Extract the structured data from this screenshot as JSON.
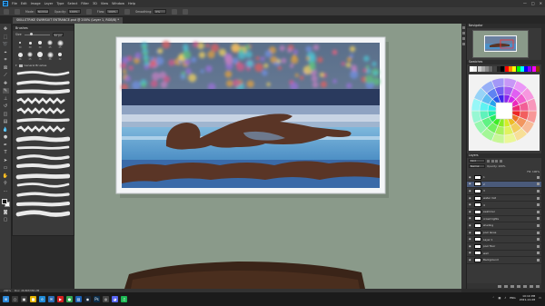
{
  "app": {
    "logo_text": "Ps",
    "menu": [
      "File",
      "Edit",
      "Image",
      "Layer",
      "Type",
      "Select",
      "Filter",
      "3D",
      "View",
      "Window",
      "Help"
    ],
    "window_controls": [
      "—",
      "□",
      "✕"
    ]
  },
  "options_bar": {
    "mode_label": "Mode:",
    "mode_value": "Normal",
    "opacity_label": "Opacity:",
    "opacity_value": "100%",
    "flow_label": "Flow:",
    "flow_value": "100%",
    "smoothing_label": "Smoothing:",
    "smoothing_value": "0%"
  },
  "document": {
    "tab_title": "SKILLSTRIKE SWIMSUIT ENTRANCE.psd @ 200% (Layer 1, RGB/8) *",
    "status_zoom": "200%",
    "status_doc": "Doc: 26.8M/336.2M"
  },
  "brushes_panel": {
    "title": "Brushes",
    "size_label": "Size",
    "size_value": "50 px",
    "preset_sizes": [
      "30",
      "30",
      "30",
      "25",
      "25",
      "36",
      "25",
      "36",
      "36",
      "32"
    ],
    "folder_label": "General Brushes"
  },
  "right_panels": {
    "navigator_title": "Navigator",
    "swatches_title": "Swatches",
    "layers_title": "Layers",
    "kind_label": "Kind",
    "blend_mode": "Normal",
    "opacity_label": "Opacity: 100%",
    "fill_label": "Fill: 100%",
    "layers": [
      {
        "name": "1",
        "selected": false
      },
      {
        "name": "2",
        "selected": true
      },
      {
        "name": "3",
        "selected": false
      },
      {
        "name": "water mid",
        "selected": false
      },
      {
        "name": "4",
        "selected": false
      },
      {
        "name": "swimmer",
        "selected": false
      },
      {
        "name": "crowd lights",
        "selected": false
      },
      {
        "name": "shading",
        "selected": false
      },
      {
        "name": "pool lanes",
        "selected": false
      },
      {
        "name": "Layer 1",
        "selected": false
      },
      {
        "name": "pool floor",
        "selected": false
      },
      {
        "name": "wall",
        "selected": false
      },
      {
        "name": "Background",
        "selected": false
      }
    ]
  },
  "taskbar": {
    "time": "10:10 PM",
    "date": "2021-12-08",
    "lang": "ENG",
    "icons": [
      {
        "name": "start",
        "color": "#2b88d8",
        "glyph": "⊞"
      },
      {
        "name": "search",
        "color": "#3a3a3a",
        "glyph": "○"
      },
      {
        "name": "task-view",
        "color": "#3a3a3a",
        "glyph": "▣"
      },
      {
        "name": "explorer",
        "color": "#e6b400",
        "glyph": "■"
      },
      {
        "name": "edge",
        "color": "#1f8ad6",
        "glyph": "e"
      },
      {
        "name": "mail",
        "color": "#2a6bb3",
        "glyph": "✉"
      },
      {
        "name": "youtube",
        "color": "#d62020",
        "glyph": "▶"
      },
      {
        "name": "chrome",
        "color": "#34a853",
        "glyph": "●"
      },
      {
        "name": "photos",
        "color": "#1a5fb4",
        "glyph": "▧"
      },
      {
        "name": "steam",
        "color": "#1b2838",
        "glyph": "◉"
      },
      {
        "name": "photoshop",
        "color": "#0b2d4a",
        "glyph": "Ps"
      },
      {
        "name": "obs",
        "color": "#444444",
        "glyph": "◎"
      },
      {
        "name": "discord",
        "color": "#5865f2",
        "glyph": "◕"
      },
      {
        "name": "spotify",
        "color": "#1db954",
        "glyph": "♫"
      }
    ]
  },
  "colors": {
    "accent": "#31a8ff",
    "workspace_bg": "#8a9a8a",
    "selected_layer": "#4a5a7a"
  }
}
